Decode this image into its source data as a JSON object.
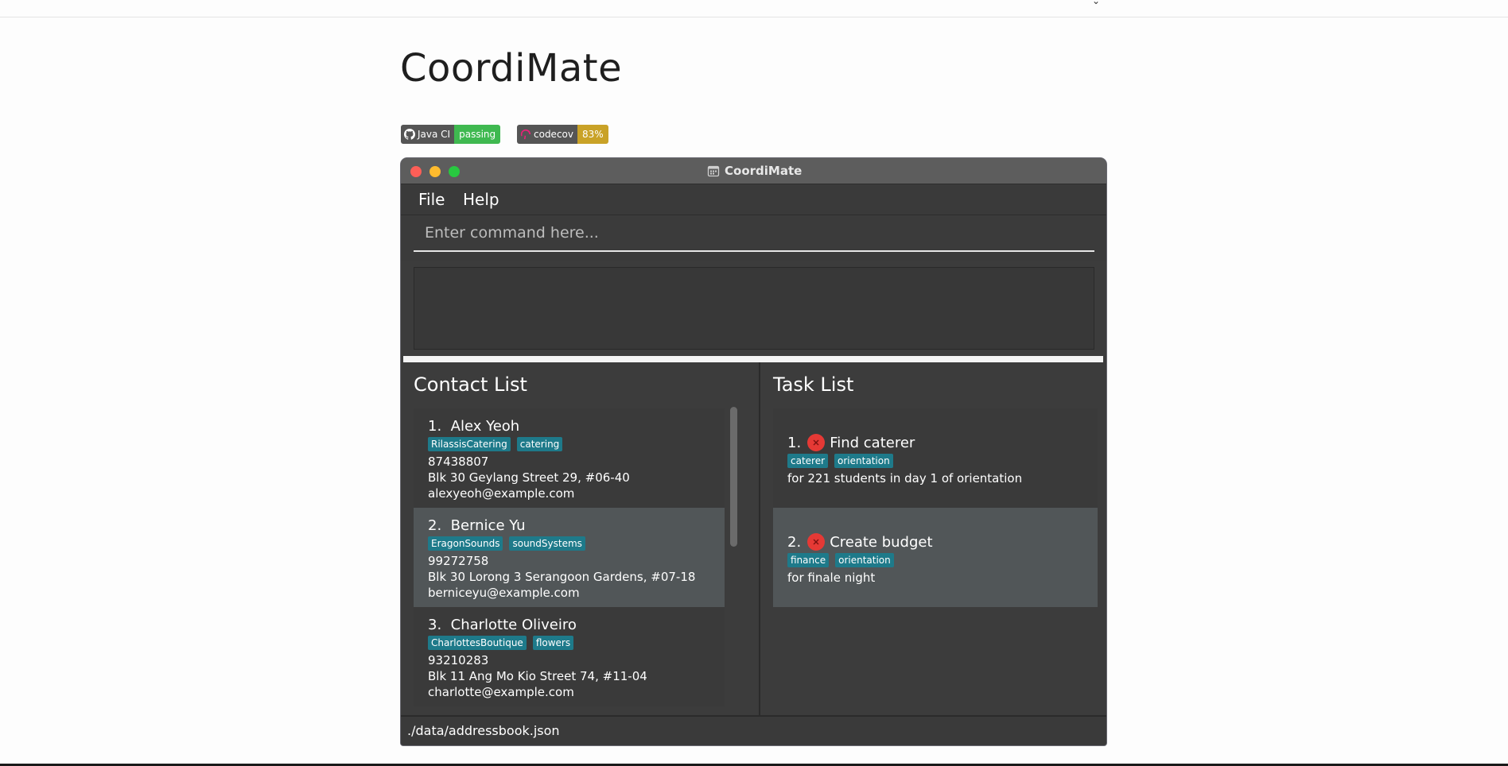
{
  "readme": {
    "title": "CoordiMate",
    "badges": [
      {
        "label": "Java CI",
        "value": "passing",
        "color": "#4c1"
      },
      {
        "label": "codecov",
        "value": "83%",
        "color": "#c9a227"
      }
    ]
  },
  "window": {
    "title": "CoordiMate",
    "menu": [
      "File",
      "Help"
    ],
    "command_placeholder": "Enter command here...",
    "status_path": "./data/addressbook.json"
  },
  "contacts": {
    "title": "Contact List",
    "items": [
      {
        "index": "1.",
        "name": "Alex Yeoh",
        "tags": [
          "RilassisCatering",
          "catering"
        ],
        "phone": "87438807",
        "address": "Blk 30 Geylang Street 29, #06-40",
        "email": "alexyeoh@example.com"
      },
      {
        "index": "2.",
        "name": "Bernice Yu",
        "tags": [
          "EragonSounds",
          "soundSystems"
        ],
        "phone": "99272758",
        "address": "Blk 30 Lorong 3 Serangoon Gardens, #07-18",
        "email": "berniceyu@example.com"
      },
      {
        "index": "3.",
        "name": "Charlotte Oliveiro",
        "tags": [
          "CharlottesBoutique",
          "flowers"
        ],
        "phone": "93210283",
        "address": "Blk 11 Ang Mo Kio Street 74, #11-04",
        "email": "charlotte@example.com"
      }
    ]
  },
  "tasks": {
    "title": "Task List",
    "items": [
      {
        "index": "1.",
        "name": "Find caterer",
        "tags": [
          "caterer",
          "orientation"
        ],
        "note": "for 221 students in day 1 of orientation"
      },
      {
        "index": "2.",
        "name": "Create budget",
        "tags": [
          "finance",
          "orientation"
        ],
        "note": "for finale night"
      }
    ]
  },
  "colors": {
    "tag": "#1e7a8a",
    "not_done": "#e53935",
    "accent_bg": "#3c3c3c"
  }
}
